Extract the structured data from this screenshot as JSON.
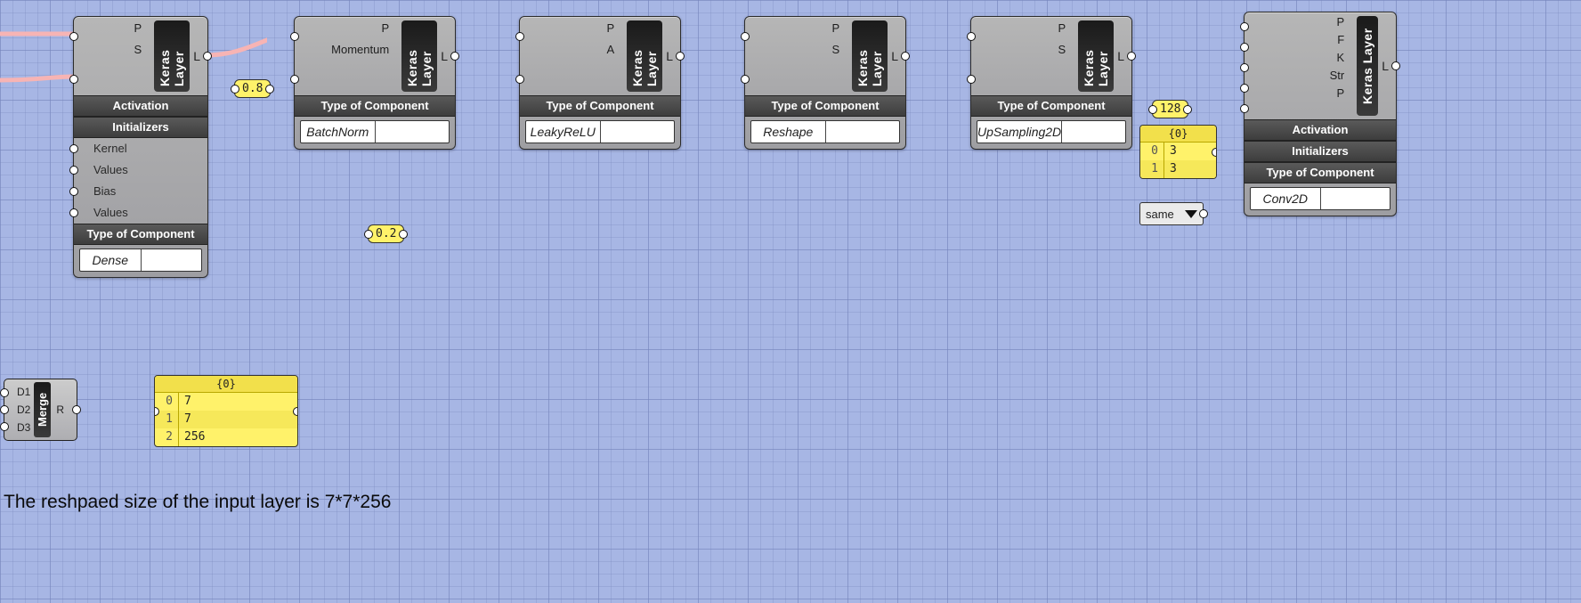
{
  "badge": "Keras Layer",
  "sections": {
    "activation": "Activation",
    "initializers": "Initializers",
    "type": "Type of Component"
  },
  "nodes": {
    "dense": {
      "inputs": [
        "P",
        "S"
      ],
      "output": "L",
      "type": "Dense",
      "init": [
        "Kernel",
        "Values",
        "Bias",
        "Values"
      ]
    },
    "batchnorm": {
      "inputs": [
        "P",
        "Momentum"
      ],
      "output": "L",
      "type": "BatchNorm"
    },
    "leakyrelu": {
      "inputs": [
        "P",
        "A"
      ],
      "output": "L",
      "type": "LeakyReLU"
    },
    "reshape": {
      "inputs": [
        "P",
        "S"
      ],
      "output": "L",
      "type": "Reshape"
    },
    "upsample": {
      "inputs": [
        "P",
        "S"
      ],
      "output": "L",
      "type": "UpSampling2D"
    },
    "conv2d": {
      "inputs": [
        "P",
        "F",
        "K",
        "Str",
        "P"
      ],
      "output": "L",
      "type": "Conv2D"
    }
  },
  "chips": {
    "momentum": "0.8",
    "leaky_alpha": "0.2",
    "filters": "128",
    "padding": "same"
  },
  "panels": {
    "kernel": {
      "title": "{0}",
      "rows": [
        {
          "idx": "0",
          "val": "3"
        },
        {
          "idx": "1",
          "val": "3"
        }
      ]
    },
    "reshape": {
      "title": "{0}",
      "rows": [
        {
          "idx": "0",
          "val": "7"
        },
        {
          "idx": "1",
          "val": "7"
        },
        {
          "idx": "2",
          "val": "256"
        }
      ]
    }
  },
  "merge": {
    "label": "Merge",
    "inputs": [
      "D1",
      "D2",
      "D3"
    ],
    "output": "R"
  },
  "caption": "The reshpaed size of the input layer is 7*7*256"
}
